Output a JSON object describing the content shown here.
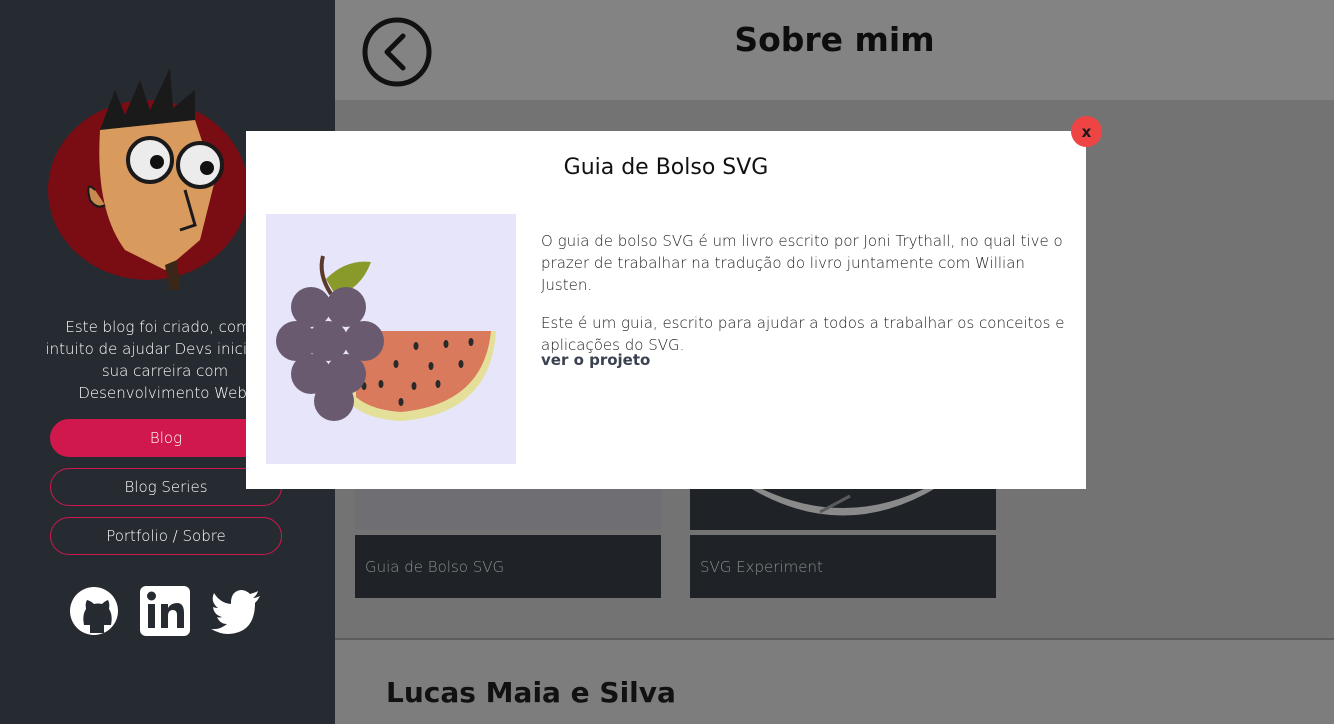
{
  "header": {
    "title": "Sobre mim"
  },
  "sidebar": {
    "bio": "Este blog foi criado, com o intuito de ajudar Devs iniciando sua carreira com Desenvolvimento Web.",
    "nav": [
      {
        "label": "Blog",
        "active": true
      },
      {
        "label": "Blog Series",
        "active": false
      },
      {
        "label": "Portfolio / Sobre",
        "active": false
      }
    ],
    "social": [
      "github-icon",
      "linkedin-icon",
      "twitter-icon"
    ]
  },
  "cards": [
    {
      "label": "Guia de Bolso SVG"
    },
    {
      "label": "SVG Experiment"
    }
  ],
  "footer": {
    "name": "Lucas Maia e Silva"
  },
  "modal": {
    "title": "Guia de Bolso SVG",
    "paragraph1": "O guia de bolso SVG é um livro escrito por Joni Trythall, no qual tive o prazer de trabalhar na tradução do livro juntamente com Willian Justen.",
    "paragraph2": "Este é um guia, escrito para ajudar a todos a trabalhar os conceitos e aplicações do SVG.",
    "link": "ver o projeto",
    "close": "x"
  },
  "colors": {
    "accent": "#d0184c",
    "close": "#ef4444",
    "sidebar": "#262b31"
  }
}
